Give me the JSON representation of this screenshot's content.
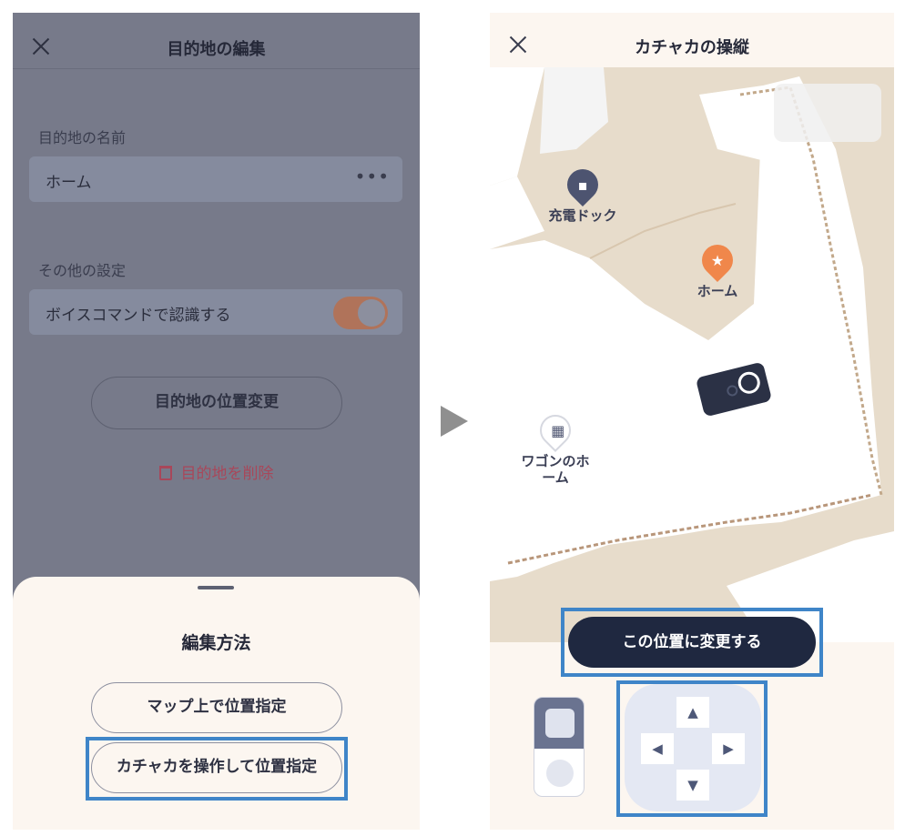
{
  "left": {
    "title": "目的地の編集",
    "name_section_label": "目的地の名前",
    "name_value": "ホーム",
    "more_label": "•••",
    "other_section_label": "その他の設定",
    "voice_command_label": "ボイスコマンドで認識する",
    "voice_command_enabled": true,
    "change_location_label": "目的地の位置変更",
    "delete_label": "目的地を削除",
    "sheet": {
      "title": "編集方法",
      "option_map": "マップ上で位置指定",
      "option_robot": "カチャカを操作して位置指定"
    }
  },
  "right": {
    "title": "カチャカの操縦",
    "pois": [
      {
        "label": "充電ドック",
        "icon": "charging-dock-icon",
        "color": "#4d5470"
      },
      {
        "label": "ホーム",
        "icon": "star-icon",
        "color": "#f0874b"
      },
      {
        "label": "ワゴンのホーム",
        "icon": "wagon-icon",
        "color": "#4d5470"
      }
    ],
    "confirm_label": "この位置に変更する",
    "dpad": {
      "up": "▲",
      "down": "▼",
      "left": "◀",
      "right": "▶"
    }
  },
  "colors": {
    "highlight": "#3f85c8",
    "accent_orange": "#f0874b",
    "navy": "#1f2840",
    "delete_red": "#a8475a"
  }
}
